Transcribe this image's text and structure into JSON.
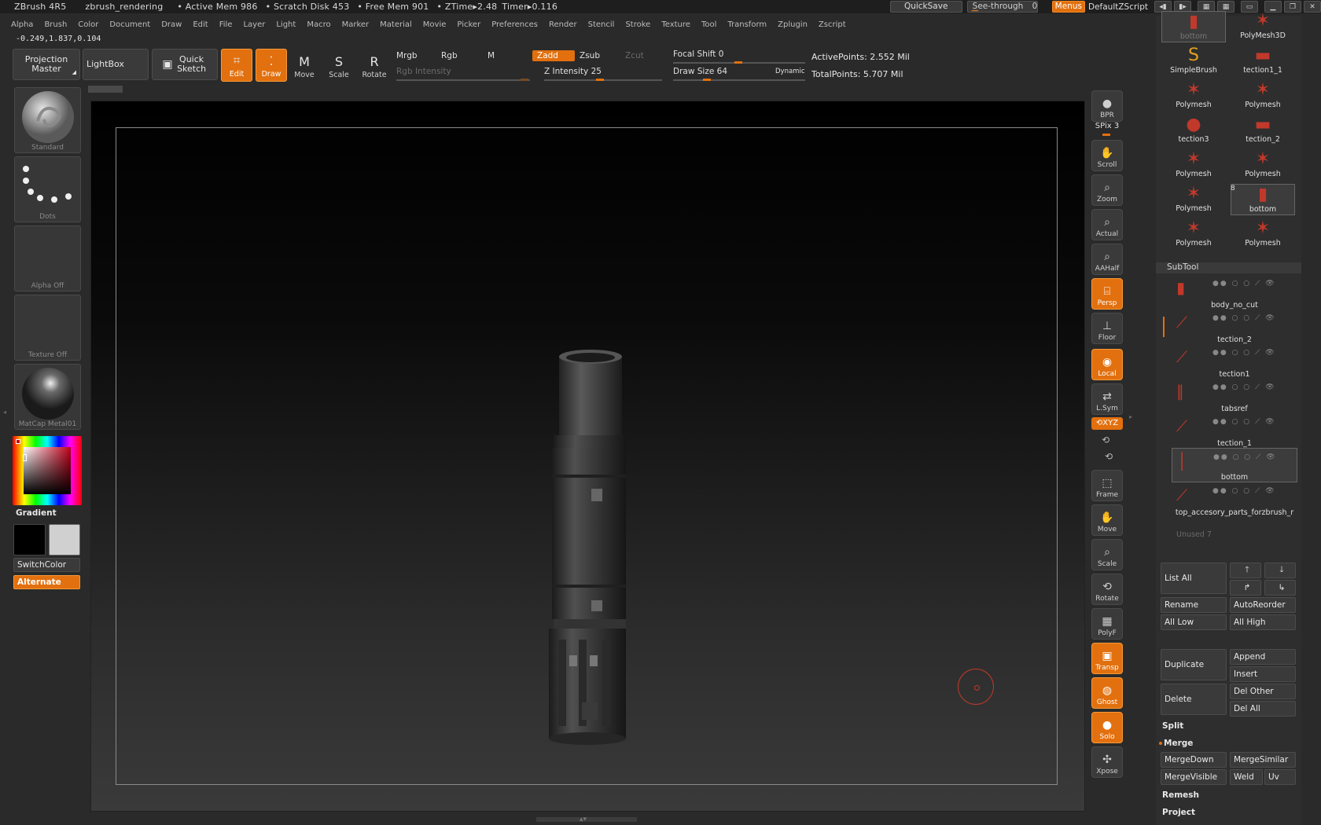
{
  "titlebar": {
    "app": "ZBrush 4R5",
    "doc": "zbrush_rendering",
    "active_mem": "• Active Mem 986",
    "scratch": "• Scratch Disk 453",
    "free_mem": "• Free Mem 901",
    "ztime": "• ZTime▸2.48",
    "timer": "Timer▸0.116",
    "quicksave": "QuickSave",
    "seethrough": "See-through",
    "seethrough_val": "0",
    "menus": "Menus",
    "defaultzscript": "DefaultZScript"
  },
  "menus": [
    "Alpha",
    "Brush",
    "Color",
    "Document",
    "Draw",
    "Edit",
    "File",
    "Layer",
    "Light",
    "Macro",
    "Marker",
    "Material",
    "Movie",
    "Picker",
    "Preferences",
    "Render",
    "Stencil",
    "Stroke",
    "Texture",
    "Tool",
    "Transform",
    "Zplugin",
    "Zscript"
  ],
  "coords": "-0.249,1.837,0.104",
  "shelf": {
    "projection_master": "Projection Master",
    "lightbox": "LightBox",
    "quick_sketch": "Quick Sketch",
    "edit": "Edit",
    "draw": "Draw",
    "move": "Move",
    "scale": "Scale",
    "rotate": "Rotate",
    "mrgb": "Mrgb",
    "rgb": "Rgb",
    "m": "M",
    "zadd": "Zadd",
    "zsub": "Zsub",
    "zcut": "Zcut",
    "rgb_intensity": "Rgb Intensity",
    "z_intensity": "Z Intensity 25",
    "focal_shift": "Focal Shift 0",
    "draw_size": "Draw Size 64",
    "dynamic": "Dynamic",
    "active_points": "ActivePoints: 2.552 Mil",
    "total_points": "TotalPoints: 5.707 Mil"
  },
  "left": {
    "brush": "Standard",
    "stroke": "Dots",
    "alpha": "Alpha Off",
    "texture": "Texture Off",
    "material": "MatCap Metal01",
    "gradient": "Gradient",
    "switchcolor": "SwitchColor",
    "alternate": "Alternate"
  },
  "right_tools": [
    {
      "name": "bpr",
      "label": "BPR",
      "on": false
    },
    {
      "name": "scroll",
      "label": "Scroll",
      "on": false
    },
    {
      "name": "zoom",
      "label": "Zoom",
      "on": false
    },
    {
      "name": "actual",
      "label": "Actual",
      "on": false
    },
    {
      "name": "aahalf",
      "label": "AAHalf",
      "on": false
    },
    {
      "name": "persp",
      "label": "Persp",
      "on": true
    },
    {
      "name": "floor",
      "label": "Floor",
      "on": false
    },
    {
      "name": "local",
      "label": "Local",
      "on": true
    },
    {
      "name": "lsym",
      "label": "L.Sym",
      "on": false
    },
    {
      "name": "frame",
      "label": "Frame",
      "on": false
    },
    {
      "name": "move",
      "label": "Move",
      "on": false
    },
    {
      "name": "scale",
      "label": "Scale",
      "on": false
    },
    {
      "name": "rotate",
      "label": "Rotate",
      "on": false
    },
    {
      "name": "polyf",
      "label": "PolyF",
      "on": false
    },
    {
      "name": "transp",
      "label": "Transp",
      "on": true
    },
    {
      "name": "ghost",
      "label": "Ghost",
      "on": true
    },
    {
      "name": "solo",
      "label": "Solo",
      "on": true
    },
    {
      "name": "xpose",
      "label": "Xpose",
      "on": false
    }
  ],
  "spix": "SPix 3",
  "xyz": "XYZ",
  "tool_thumbs": [
    {
      "name": "bottom",
      "icon": "▮"
    },
    {
      "name": "PolyMesh3D",
      "icon": "✶"
    },
    {
      "name": "SimpleBrush",
      "icon": "S"
    },
    {
      "name": "tection1_1",
      "icon": "▬"
    },
    {
      "name": "Polymesh",
      "icon": "✶"
    },
    {
      "name": "Polymesh",
      "icon": "✶"
    },
    {
      "name": "tection3",
      "icon": "●"
    },
    {
      "name": "tection_2",
      "icon": "▬"
    },
    {
      "name": "Polymesh",
      "icon": "✶"
    },
    {
      "name": "Polymesh",
      "icon": "✶"
    },
    {
      "name": "Polymesh",
      "icon": "✶"
    },
    {
      "name": "bottom",
      "icon": "▮"
    },
    {
      "name": "Polymesh",
      "icon": "✶"
    },
    {
      "name": "Polymesh",
      "icon": "✶"
    }
  ],
  "tool_count": "8",
  "subtool": {
    "title": "SubTool",
    "items": [
      "body_no_cut",
      "tection_2",
      "tection1",
      "tabsref",
      "tection_1",
      "bottom",
      "top_accesory_parts_forzbrush_r"
    ],
    "unused": "Unused 7",
    "list_all": "List All",
    "rename": "Rename",
    "autoreorder": "AutoReorder",
    "all_low": "All Low",
    "all_high": "All High",
    "duplicate": "Duplicate",
    "append": "Append",
    "insert": "Insert",
    "delete": "Delete",
    "del_other": "Del Other",
    "del_all": "Del All",
    "split": "Split",
    "merge": "Merge",
    "mergedown": "MergeDown",
    "mergesimilar": "MergeSimilar",
    "mergevisible": "MergeVisible",
    "weld": "Weld",
    "uv": "Uv",
    "remesh": "Remesh",
    "project": "Project"
  }
}
